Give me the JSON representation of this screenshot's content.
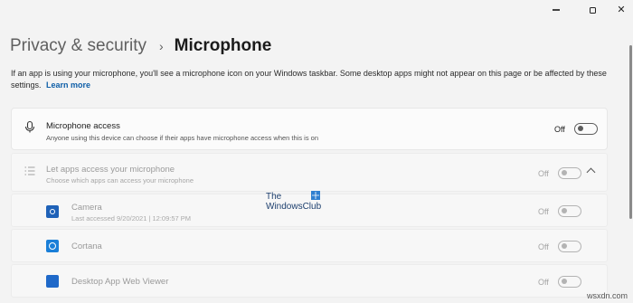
{
  "breadcrumb": {
    "parent": "Privacy & security",
    "separator": "›",
    "current": "Microphone"
  },
  "description": {
    "text": "If an app is using your microphone, you'll see a microphone icon on your Windows taskbar. Some desktop apps might not appear on this page or be affected by these settings.",
    "link": "Learn more"
  },
  "mic_access": {
    "title": "Microphone access",
    "subtitle": "Anyone using this device can choose if their apps have microphone access when this is on",
    "state": "Off",
    "icon": "microphone-icon"
  },
  "apps_access": {
    "title": "Let apps access your microphone",
    "subtitle": "Choose which apps can access your microphone",
    "state": "Off",
    "icon": "list-icon"
  },
  "apps": [
    {
      "name": "Camera",
      "detail": "Last accessed 9/20/2021  |  12:09:57 PM",
      "state": "Off",
      "icon": "camera-icon"
    },
    {
      "name": "Cortana",
      "detail": "",
      "state": "Off",
      "icon": "cortana-icon"
    },
    {
      "name": "Desktop App Web Viewer",
      "detail": "",
      "state": "Off",
      "icon": "webview-icon"
    }
  ],
  "watermark": {
    "line1": "The",
    "line2": "WindowsClub"
  },
  "footer_mark": "wsxdn.com",
  "colors": {
    "background": "#f3f3f3",
    "card": "#fbfbfb",
    "link": "#0f5fa8",
    "app_icon": "#1f62b8"
  }
}
